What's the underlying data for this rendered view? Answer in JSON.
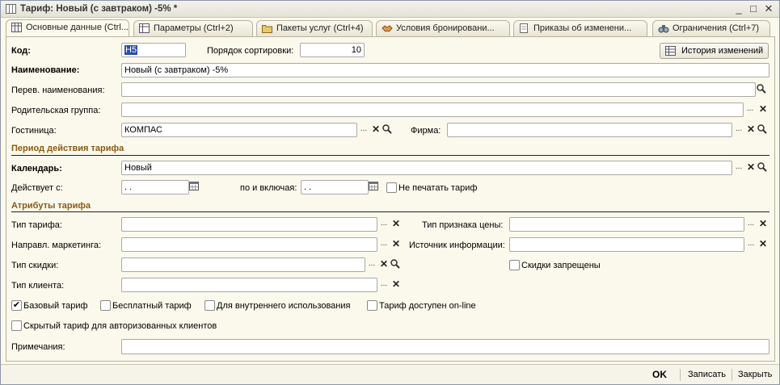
{
  "window": {
    "title": "Тариф: Новый (с завтраком) -5% *"
  },
  "tabs": [
    {
      "label": "Основные данные (Ctrl..."
    },
    {
      "label": "Параметры (Ctrl+2)"
    },
    {
      "label": "Пакеты услуг (Ctrl+4)"
    },
    {
      "label": "Условия бронировани..."
    },
    {
      "label": "Приказы об изменени..."
    },
    {
      "label": "Ограничения (Ctrl+7)"
    }
  ],
  "form": {
    "code_label": "Код:",
    "code_value": "H5",
    "sort_label": "Порядок сортировки:",
    "sort_value": "10",
    "history_button": "История изменений",
    "name_label": "Наименование:",
    "name_value": "Новый (с завтраком) -5%",
    "trans_label": "Перев. наименования:",
    "trans_value": "",
    "parent_label": "Родительская группа:",
    "parent_value": "",
    "hotel_label": "Гостиница:",
    "hotel_value": "КОМПАС",
    "firm_label": "Фирма:",
    "firm_value": ""
  },
  "period": {
    "header": "Период действия тарифа",
    "calendar_label": "Календарь:",
    "calendar_value": "Новый",
    "from_label": "Действует с:",
    "from_value": " .  .",
    "to_label": "по и включая:",
    "to_value": " .  .",
    "no_print_label": "Не печатать тариф"
  },
  "attrs": {
    "header": "Атрибуты тарифа",
    "type_label": "Тип тарифа:",
    "type_value": "",
    "price_sign_label": "Тип признака цены:",
    "price_sign_value": "",
    "marketing_label": "Направл. маркетинга:",
    "marketing_value": "",
    "source_label": "Источник информации:",
    "source_value": "",
    "discount_type_label": "Тип скидки:",
    "discount_type_value": "",
    "discounts_forbidden_label": "Скидки запрещены",
    "client_type_label": "Тип клиента:",
    "client_type_value": ""
  },
  "flags": {
    "base_label": "Базовый тариф",
    "base_checked": "✔",
    "free_label": "Бесплатный тариф",
    "internal_label": "Для внутреннего использования",
    "online_label": "Тариф доступен on-line",
    "hidden_label": "Скрытый тариф для авторизованных клиентов"
  },
  "notes": {
    "label": "Примечания:",
    "value": ""
  },
  "footer": {
    "ok": "OK",
    "save": "Записать",
    "close": "Закрыть"
  },
  "icons": {
    "select": "...",
    "clear": "✕",
    "search": "magnifier-icon",
    "calendar": "calendar-icon"
  }
}
